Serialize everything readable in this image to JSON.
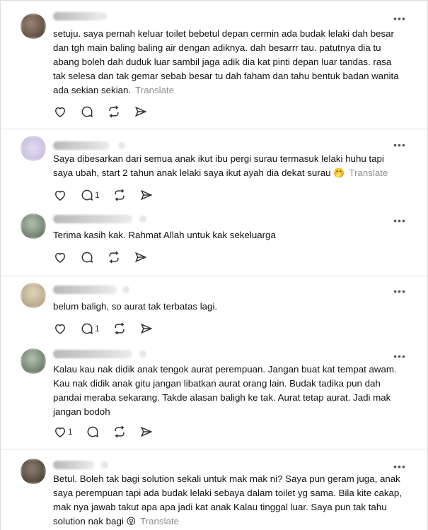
{
  "posts": [
    {
      "username": "ahmadzhyrq",
      "timestamp": "1d",
      "avatar_color": "#7a6a5e",
      "text": "setuju. saya pernah keluar toilet bebetul depan cermin ada budak lelaki dah besar dan tgh main baling baling air dengan adiknya. dah besarrr tau. patutnya dia tu abang boleh dah duduk luar sambil jaga adik dia kat pinti depan luar tandas. rasa tak selesa dan tak gemar sebab besar tu dah faham dan tahu bentuk badan wanita ada sekian sekian.",
      "translate_label": "Translate",
      "reply_count": ""
    },
    {
      "username": "jadihaninoor",
      "timestamp": "1d",
      "avatar_color": "#d9d4ea",
      "text": "Saya dibesarkan dari semua anak ikut ibu pergi surau termasuk lelaki huhu tapi saya ubah, start 2 tahun anak lelaki saya ikut ayah dia dekat surau",
      "emoji": "🤭",
      "translate_label": "Translate",
      "reply_count": "1"
    },
    {
      "username": "nurul_aatifa_alias",
      "timestamp": "1d",
      "avatar_color": "#8a9a88",
      "text": "Terima kasih kak. Rahmat Allah untuk kak sekeluarga",
      "translate_label": "",
      "reply_count": ""
    },
    {
      "username": "aisyahnadzirah",
      "timestamp": "1d",
      "avatar_color": "#c9b99a",
      "text": "belum baligh, so aurat tak terbatas lagi.",
      "translate_label": "",
      "reply_count": "1"
    },
    {
      "username": "nurul_aatifa_alias",
      "timestamp": "1d",
      "avatar_color": "#8a9a88",
      "text": "Kalau kau nak didik anak tengok aurat perempuan. Jangan buat kat tempat awam. Kau nak didik anak gitu jangan libatkan aurat orang lain. Budak tadika pun dah pandai meraba sekarang. Takde alasan baligh ke tak. Aurat tetap aurat. Jadi mak jangan bodoh",
      "translate_label": "",
      "like_count": "1",
      "reply_count": ""
    },
    {
      "username": "fhzahair",
      "timestamp": "1d",
      "avatar_color": "#6e6254",
      "text": "Betul. Boleh tak bagi solution sekali untuk mak mak ni? Saya pun geram juga, anak saya perempuan tapi ada budak lelaki sebaya dalam toilet yg sama. Bila kite cakap, mak nya jawab takut apa apa jadi kat anak Kalau tinggal luar. Saya pun tak tahu solution nak bagi",
      "emoji": "😝",
      "translate_label": "Translate",
      "reply_count": ""
    }
  ],
  "icons": {
    "like": "heart-icon",
    "reply": "comment-icon",
    "repost": "repost-icon",
    "share": "share-icon",
    "more": "more-icon"
  }
}
